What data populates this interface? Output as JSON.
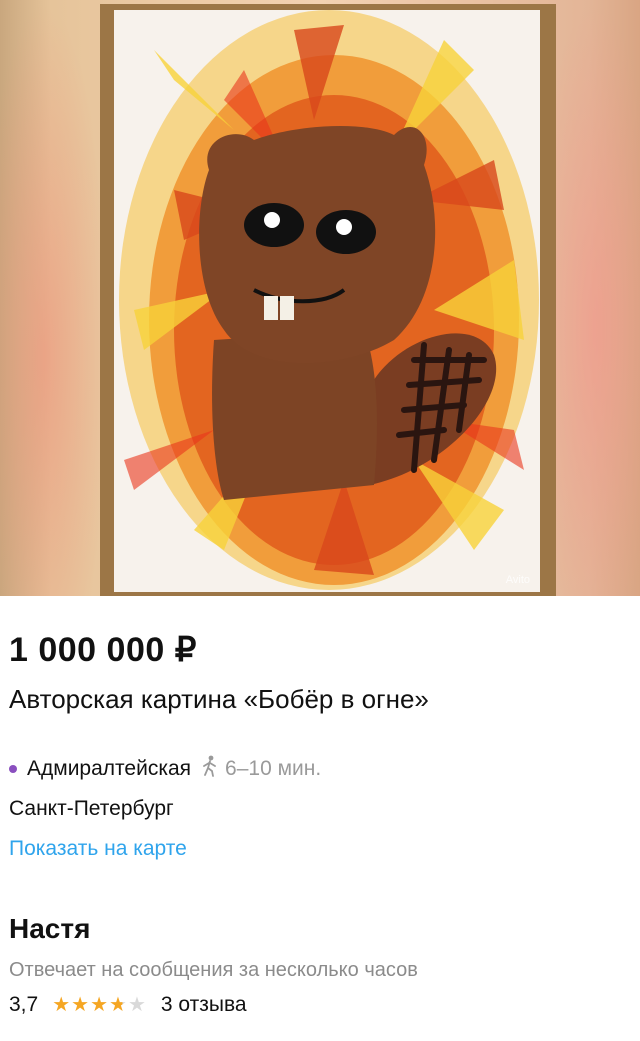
{
  "listing": {
    "price": "1 000 000 ₽",
    "title": "Авторская картина «Бобёр в огне»",
    "watermark": "Avito"
  },
  "location": {
    "metro": "Адмиралтейская",
    "walk_time": "6–10 мин.",
    "metro_color": "#8a4fbf",
    "city": "Санкт-Петербург",
    "map_link": "Показать на карте"
  },
  "seller": {
    "name": "Настя",
    "response_time": "Отвечает на сообщения за несколько часов",
    "rating": "3,7",
    "rating_value": 3.7,
    "reviews": "3 отзыва"
  }
}
